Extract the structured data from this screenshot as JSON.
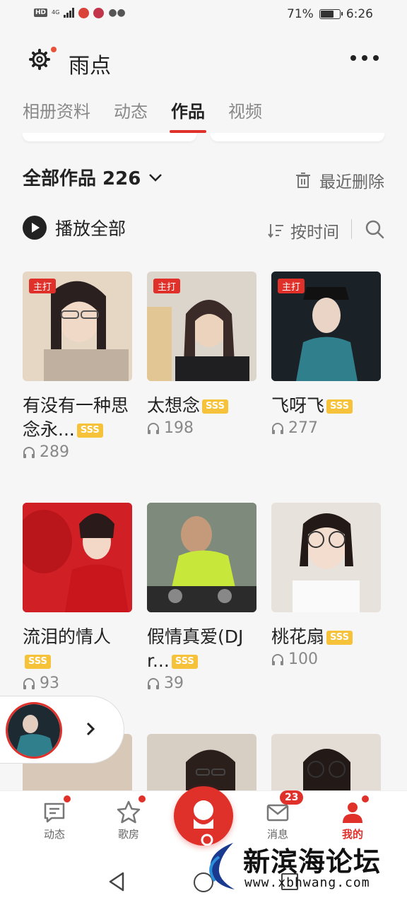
{
  "status_bar": {
    "hd": "HD",
    "net": "4G",
    "battery": "71%",
    "battery_level": 0.71,
    "time": "6:26"
  },
  "header": {
    "title": "雨点",
    "left_icon": "gear-icon",
    "right_icon": "more-icon"
  },
  "tabs": [
    {
      "label": "相册资料",
      "active": false
    },
    {
      "label": "动态",
      "active": false
    },
    {
      "label": "作品",
      "active": true
    },
    {
      "label": "视频",
      "active": false
    }
  ],
  "works": {
    "title": "全部作品 226",
    "recent_delete": "最近删除",
    "play_all": "播放全部",
    "sort_label": "按时间"
  },
  "items": [
    {
      "title": "有没有一种思念永...",
      "badge": "主打",
      "sss": "SSS",
      "plays": "289",
      "cover": "#e6d6c4"
    },
    {
      "title": "太想念",
      "badge": "主打",
      "sss": "SSS",
      "plays": "198",
      "cover": "#dcd5cc"
    },
    {
      "title": "飞呀飞",
      "badge": "主打",
      "sss": "SSS",
      "plays": "277",
      "cover": "#2b4a58"
    },
    {
      "title": "流泪的情人",
      "badge": "",
      "sss": "SSS",
      "plays": "93",
      "cover": "#d3232a"
    },
    {
      "title": "假情真爱(DJ r...",
      "badge": "",
      "sss": "SSS",
      "plays": "39",
      "cover": "#5c6b5a"
    },
    {
      "title": "桃花扇",
      "badge": "",
      "sss": "SSS",
      "plays": "100",
      "cover": "#e8e2dc"
    },
    {
      "title": "",
      "badge": "",
      "sss": "",
      "plays": "",
      "cover": "#d8c8b8"
    },
    {
      "title": "",
      "badge": "",
      "sss": "",
      "plays": "",
      "cover": "#d8cfc4"
    },
    {
      "title": "",
      "badge": "",
      "sss": "",
      "plays": "",
      "cover": "#e4ddd6"
    }
  ],
  "tabbar": {
    "items": [
      {
        "label": "动态",
        "icon": "chat-icon",
        "dot": true
      },
      {
        "label": "歌房",
        "icon": "star-icon",
        "dot": true
      },
      {
        "label": "消息",
        "icon": "mail-icon",
        "badge": "23"
      },
      {
        "label": "我的",
        "icon": "person-icon",
        "active": true
      }
    ]
  },
  "watermark": {
    "text": "新滨海论坛",
    "url": "www.xbhwang.com"
  },
  "colors": {
    "accent": "#e0302a",
    "sss": "#f5c23a"
  }
}
